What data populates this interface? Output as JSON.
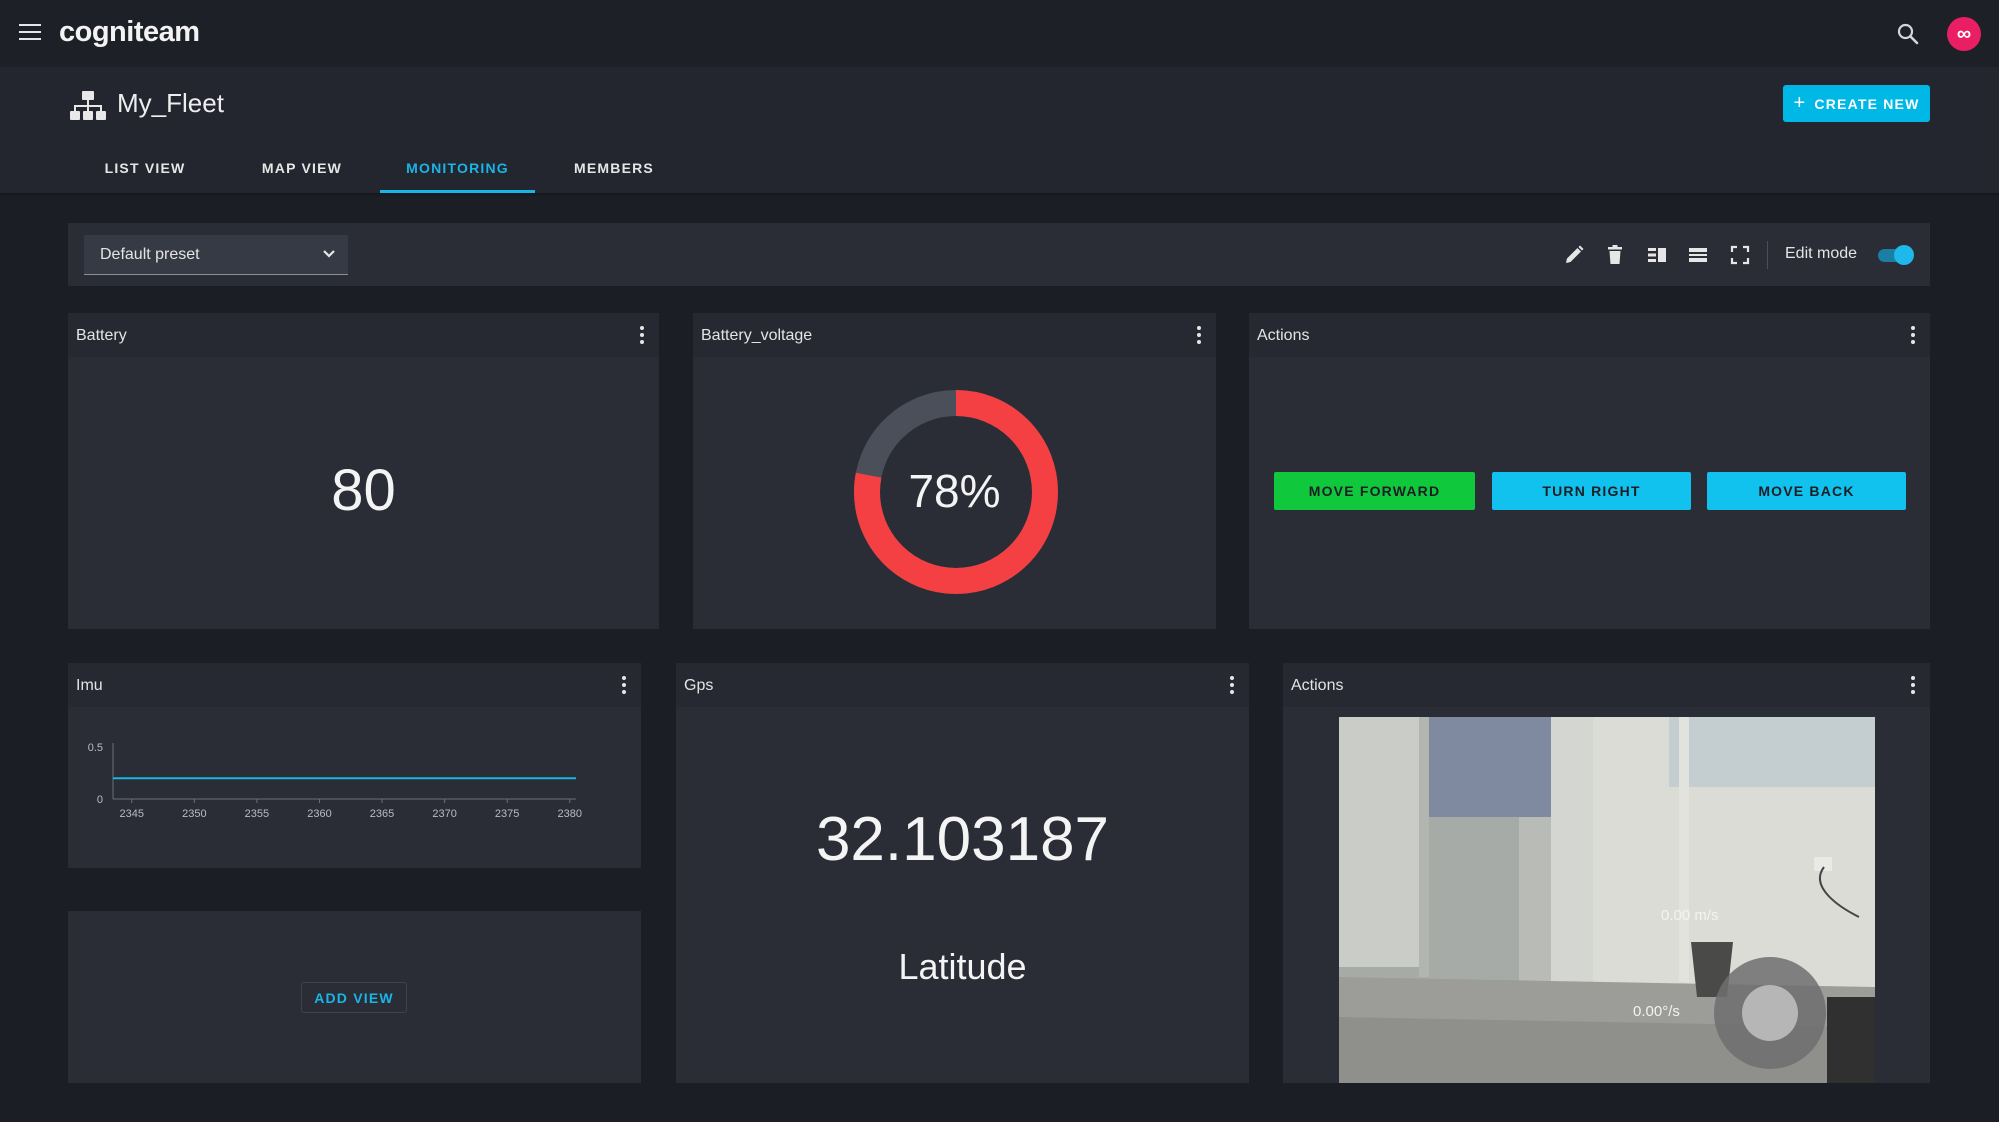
{
  "app": {
    "logo": "cogniteam",
    "avatar_glyph": "∞",
    "accent_color": "#19b5e6",
    "avatar_color": "#e91e63"
  },
  "header": {
    "fleet_name": "My_Fleet",
    "create_label": "CREATE NEW",
    "create_icon": "plus-icon"
  },
  "tabs": [
    {
      "label": "LIST VIEW",
      "active": false
    },
    {
      "label": "MAP VIEW",
      "active": false
    },
    {
      "label": "MONITORING",
      "active": true
    },
    {
      "label": "MEMBERS",
      "active": false
    }
  ],
  "toolbar": {
    "preset": "Default preset",
    "icons": [
      "pencil-icon",
      "trash-icon",
      "columns-icon",
      "rows-icon",
      "fullscreen-icon"
    ],
    "edit_mode_label": "Edit mode",
    "edit_mode_on": true
  },
  "widgets": {
    "battery": {
      "title": "Battery",
      "value": "80"
    },
    "battery_voltage": {
      "title": "Battery_voltage",
      "percent_label": "78%",
      "percent": 78,
      "fill_color": "#f44043",
      "track_color": "#4b4f5a"
    },
    "actions_top": {
      "title": "Actions",
      "buttons": [
        {
          "label": "MOVE FORWARD",
          "color": "#10c83c"
        },
        {
          "label": "TURN RIGHT",
          "color": "#11c1ee"
        },
        {
          "label": "MOVE BACK",
          "color": "#11c1ee"
        }
      ]
    },
    "imu": {
      "title": "Imu"
    },
    "add_view": {
      "label": "ADD VIEW"
    },
    "gps": {
      "title": "Gps",
      "value": "32.103187",
      "caption": "Latitude"
    },
    "actions_camera": {
      "title": "Actions",
      "speed": "0.00 m/s",
      "angular": "0.00°/s"
    }
  },
  "chart_data": {
    "type": "line",
    "title": "",
    "xlabel": "",
    "ylabel": "",
    "x_ticks": [
      2345,
      2350,
      2355,
      2360,
      2365,
      2370,
      2375,
      2380
    ],
    "y_ticks": [
      0,
      0.5
    ],
    "xlim": [
      2343.5,
      2380.5
    ],
    "ylim": [
      0,
      0.5
    ],
    "series": [
      {
        "x": [
          2343.5,
          2380.5
        ],
        "y": [
          0.2,
          0.2
        ],
        "color": "#19b5e6"
      }
    ]
  }
}
